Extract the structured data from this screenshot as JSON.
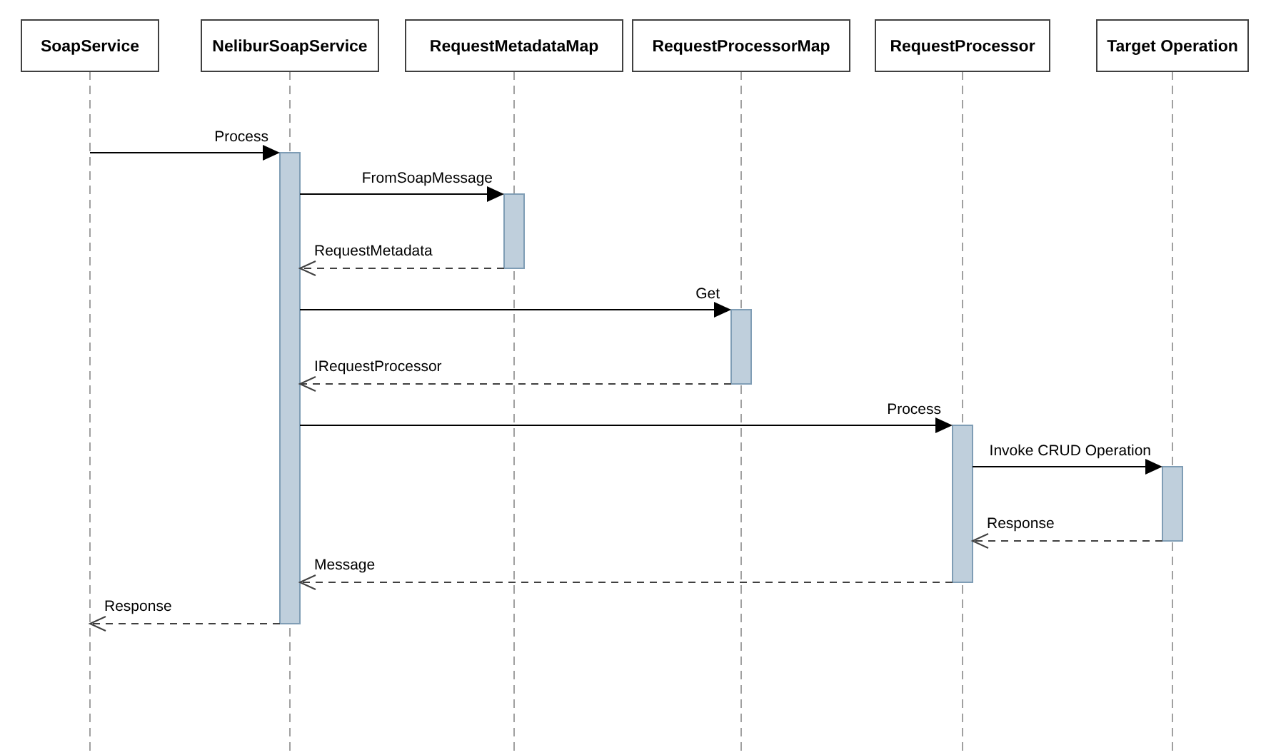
{
  "participants": [
    "SoapService",
    "NeliburSoapService",
    "RequestMetadataMap",
    "RequestProcessorMap",
    "RequestProcessor",
    "Target Operation"
  ],
  "messages": [
    {
      "kind": "call",
      "label": "Process"
    },
    {
      "kind": "call",
      "label": "FromSoapMessage"
    },
    {
      "kind": "return",
      "label": "RequestMetadata"
    },
    {
      "kind": "call",
      "label": "Get"
    },
    {
      "kind": "return",
      "label": "IRequestProcessor"
    },
    {
      "kind": "call",
      "label": "Process"
    },
    {
      "kind": "call",
      "label": "Invoke CRUD Operation"
    },
    {
      "kind": "return",
      "label": "Response"
    },
    {
      "kind": "return",
      "label": "Message"
    },
    {
      "kind": "return",
      "label": "Response"
    }
  ]
}
